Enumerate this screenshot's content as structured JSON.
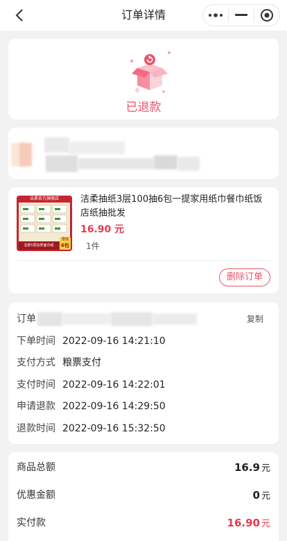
{
  "nav": {
    "title": "订单详情"
  },
  "status": {
    "text": "已退款"
  },
  "goods": {
    "title": "洁柔抽纸3层100抽6包一提家用纸巾餐巾纸饭店纸抽批发",
    "price": "16.90 元",
    "qty": "1件",
    "img_banner": "洁柔官方旗舰店",
    "img_bottom": "洁柔5层加厚面巾纸",
    "img_tag": "6包",
    "img_tag_top": "整提",
    "delete_label": "删除订单"
  },
  "order": {
    "number_label": "订单",
    "copy_label": "复制",
    "rows": [
      {
        "label": "下单时间",
        "value": "2022-09-16 14:21:10"
      },
      {
        "label": "支付方式",
        "value": "粮票支付"
      },
      {
        "label": "支付时间",
        "value": "2022-09-16 14:22:01"
      },
      {
        "label": "申请退款",
        "value": "2022-09-16 14:29:50"
      },
      {
        "label": "退款时间",
        "value": "2022-09-16 15:32:50"
      }
    ]
  },
  "totals": {
    "rows": [
      {
        "label": "商品总额",
        "amount": "16.9",
        "unit": "元"
      },
      {
        "label": "优惠金额",
        "amount": "0",
        "unit": "元"
      },
      {
        "label": "实付款",
        "amount": "16.90",
        "unit": "元"
      }
    ]
  },
  "colors": {
    "accent": "#e8546b",
    "price": "#e8384f",
    "background": "#f2f2f2"
  }
}
